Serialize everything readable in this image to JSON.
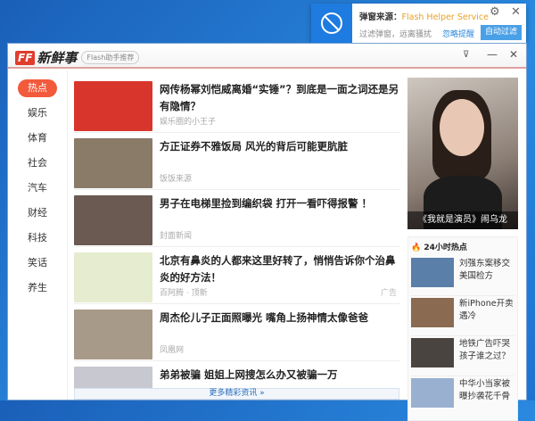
{
  "popup": {
    "source_label": "弹窗来源：",
    "source_name": "Flash Helper Service",
    "desc": "过滤弹窗，远离骚扰",
    "ignore": "忽略提醒",
    "auto_filter": "自动过滤"
  },
  "window": {
    "logo_ff": "FF",
    "logo_text": "新鲜事",
    "tag": "Flash助手推荐"
  },
  "nav": [
    "热点",
    "娱乐",
    "体育",
    "社会",
    "汽车",
    "财经",
    "科技",
    "笑话",
    "养生"
  ],
  "articles": [
    {
      "title": "网传杨幂刘恺威离婚“实锤”？到底是一面之词还是另有隐情？",
      "source": "娱乐圈的小王子",
      "color": "#d8352c"
    },
    {
      "title": "方正证券不雅饭局 风光的背后可能更肮脏",
      "source": "饭饭来源",
      "color": "#8a7a68"
    },
    {
      "title": "男子在电梯里捡到编织袋 打开一看吓得报警 ！",
      "source": "封面新闻",
      "color": "#6a5a52"
    },
    {
      "title": "北京有鼻炎的人都来这里好转了，悄悄告诉你个治鼻炎的好方法！",
      "source": "百阿腾 · 顶新",
      "ad": "广告",
      "color": "#e6ecd0"
    },
    {
      "title": "周杰伦儿子正面照曝光 嘴角上扬神情太像爸爸",
      "source": "凤凰网",
      "color": "#a89a88"
    },
    {
      "title": "弟弟被骗 姐姐上网搜怎么办又被骗一万",
      "source": "",
      "color": "#c8c8d0"
    }
  ],
  "more": "更多精彩资讯 »",
  "feature": {
    "caption": "《我就是演员》闹乌龙"
  },
  "hot": {
    "title": "24小时热点",
    "items": [
      {
        "title": "刘强东案移交美国检方",
        "color": "#5a7fa8"
      },
      {
        "title": "新iPhone开卖遇冷",
        "color": "#8a6a50"
      },
      {
        "title": "地铁广告吓哭孩子谁之过？",
        "color": "#4a4440"
      },
      {
        "title": "中华小当家被曝抄袭花千骨",
        "color": "#9ab0d0"
      }
    ]
  }
}
